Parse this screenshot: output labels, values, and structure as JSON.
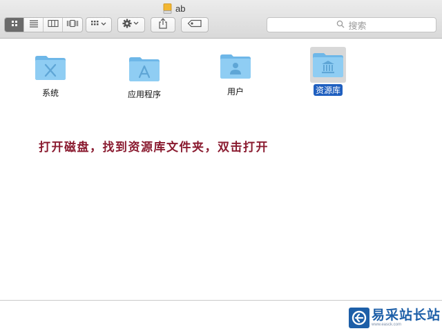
{
  "window": {
    "title": "ab",
    "title_icon": "drive-icon"
  },
  "toolbar": {
    "view_modes": [
      {
        "name": "icon-view",
        "icon": "grid-icon",
        "active": true
      },
      {
        "name": "list-view",
        "icon": "list-icon",
        "active": false
      },
      {
        "name": "column-view",
        "icon": "columns-icon",
        "active": false
      },
      {
        "name": "cover-flow-view",
        "icon": "coverflow-icon",
        "active": false
      }
    ],
    "arrange_icon": "arrange-icon",
    "action_icon": "gear-icon",
    "share_icon": "share-icon",
    "tag_icon": "tag-icon",
    "search_placeholder": "搜索",
    "search_icon": "search-icon"
  },
  "files": [
    {
      "label": "系统",
      "icon": "folder-system-icon",
      "selected": false
    },
    {
      "label": "应用程序",
      "icon": "folder-applications-icon",
      "selected": false
    },
    {
      "label": "用户",
      "icon": "folder-users-icon",
      "selected": false
    },
    {
      "label": "资源库",
      "icon": "folder-library-icon",
      "selected": true
    }
  ],
  "annotation": "打开磁盘，找到资源库文件夹，双击打开",
  "watermark": {
    "name": "易采站长站",
    "url": "www.easck.com"
  },
  "colors": {
    "annotation": "#8a1b30",
    "selection": "#1f5fbf",
    "folder": "#7cc0ec",
    "watermark": "#1d5fa8"
  }
}
